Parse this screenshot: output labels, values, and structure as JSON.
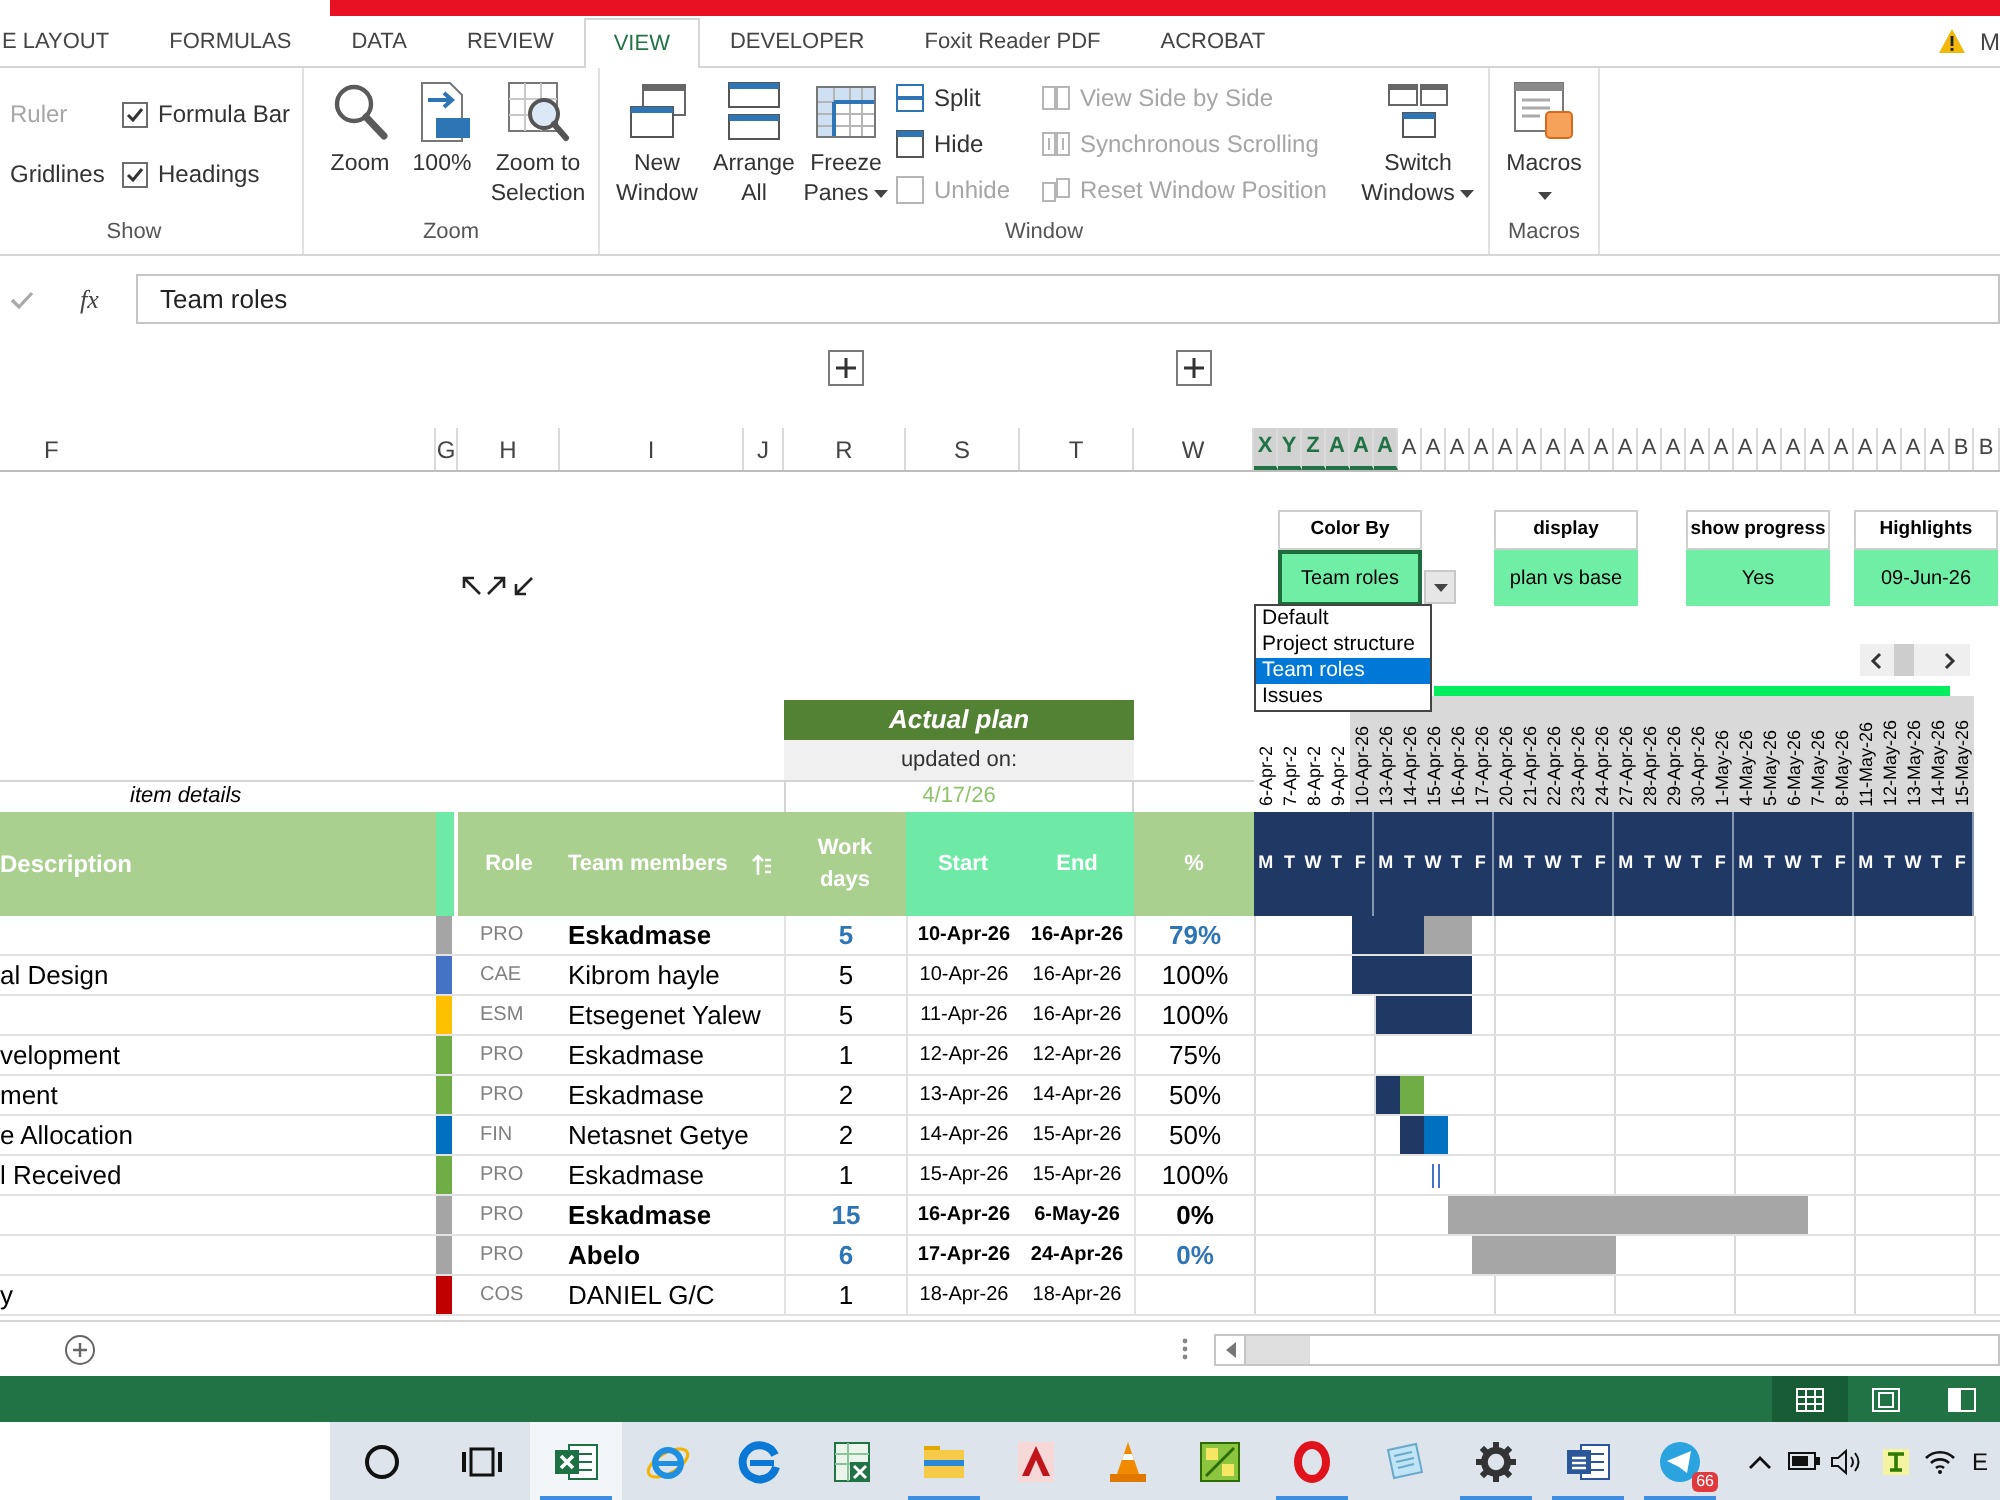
{
  "ribbon_tabs": [
    {
      "label": "E LAYOUT",
      "selected": false
    },
    {
      "label": "FORMULAS",
      "selected": false
    },
    {
      "label": "DATA",
      "selected": false
    },
    {
      "label": "REVIEW",
      "selected": false
    },
    {
      "label": "VIEW",
      "selected": true
    },
    {
      "label": "DEVELOPER",
      "selected": false
    },
    {
      "label": "Foxit Reader PDF",
      "selected": false
    },
    {
      "label": "ACROBAT",
      "selected": false
    }
  ],
  "account": {
    "name": "M"
  },
  "ribbon": {
    "show": {
      "label": "Show",
      "options": [
        {
          "kind": "label",
          "label": "Ruler",
          "disabled": true
        },
        {
          "kind": "checkbox",
          "label": "Formula Bar",
          "checked": true,
          "disabled": false
        },
        {
          "kind": "label",
          "label": "Gridlines",
          "disabled": false
        },
        {
          "kind": "checkbox",
          "label": "Headings",
          "checked": true,
          "disabled": false
        }
      ]
    },
    "zoom": {
      "label": "Zoom",
      "buttons": [
        {
          "label": "Zoom"
        },
        {
          "label": "100%"
        },
        {
          "label": "Zoom to Selection"
        }
      ]
    },
    "window": {
      "label": "Window",
      "large_buttons": [
        {
          "label": "New Window",
          "dropdown": false
        },
        {
          "label": "Arrange All",
          "dropdown": false
        },
        {
          "label": "Freeze Panes",
          "dropdown": true
        }
      ],
      "small_buttons": [
        {
          "label": "Split",
          "disabled": false
        },
        {
          "label": "Hide",
          "disabled": false
        },
        {
          "label": "Unhide",
          "disabled": true
        }
      ],
      "compare_buttons": [
        {
          "label": "View Side by Side",
          "disabled": true
        },
        {
          "label": "Synchronous Scrolling",
          "disabled": true
        },
        {
          "label": "Reset Window Position",
          "disabled": true
        }
      ],
      "switch_button": {
        "label": "Switch Windows",
        "dropdown": true
      }
    },
    "macros": {
      "label": "Macros",
      "button": {
        "label": "Macros",
        "dropdown": true
      }
    }
  },
  "formula_bar": {
    "function_button": "fx",
    "value": "Team roles"
  },
  "columns": [
    {
      "label": "F",
      "outline_expand": false
    },
    {
      "label": "G",
      "outline_expand": false
    },
    {
      "label": "H",
      "outline_expand": false
    },
    {
      "label": "I",
      "outline_expand": false
    },
    {
      "label": "J",
      "outline_expand": false
    },
    {
      "label": "R",
      "outline_expand": true
    },
    {
      "label": "S",
      "outline_expand": false
    },
    {
      "label": "T",
      "outline_expand": false
    },
    {
      "label": "W",
      "outline_expand": true
    }
  ],
  "timeline_columns": [
    {
      "label": "X",
      "selected": true
    },
    {
      "label": "Y",
      "selected": true
    },
    {
      "label": "Z",
      "selected": true
    },
    {
      "label": "A",
      "selected": true
    },
    {
      "label": "A",
      "selected": true
    },
    {
      "label": "A",
      "selected": true
    },
    {
      "label": "A",
      "selected": false
    },
    {
      "label": "A",
      "selected": false
    },
    {
      "label": "A",
      "selected": false
    },
    {
      "label": "A",
      "selected": false
    },
    {
      "label": "A",
      "selected": false
    },
    {
      "label": "A",
      "selected": false
    },
    {
      "label": "A",
      "selected": false
    },
    {
      "label": "A",
      "selected": false
    },
    {
      "label": "A",
      "selected": false
    },
    {
      "label": "A",
      "selected": false
    },
    {
      "label": "A",
      "selected": false
    },
    {
      "label": "A",
      "selected": false
    },
    {
      "label": "A",
      "selected": false
    },
    {
      "label": "A",
      "selected": false
    },
    {
      "label": "A",
      "selected": false
    },
    {
      "label": "A",
      "selected": false
    },
    {
      "label": "A",
      "selected": false
    },
    {
      "label": "A",
      "selected": false
    },
    {
      "label": "A",
      "selected": false
    },
    {
      "label": "A",
      "selected": false
    },
    {
      "label": "A",
      "selected": false
    },
    {
      "label": "A",
      "selected": false
    },
    {
      "label": "A",
      "selected": false
    },
    {
      "label": "B",
      "selected": false
    },
    {
      "label": "B",
      "selected": false
    }
  ],
  "controls": [
    {
      "kind": "dropdown",
      "label": "Color By",
      "value": "Team roles",
      "focused": true
    },
    {
      "kind": "value",
      "label": "display",
      "value": "plan vs base",
      "focused": false
    },
    {
      "kind": "value",
      "label": "show progress",
      "value": "Yes",
      "focused": false
    },
    {
      "kind": "value",
      "label": "Highlights",
      "value": "09-Jun-26",
      "focused": false
    }
  ],
  "dropdown_options": [
    {
      "label": "Default",
      "selected": false
    },
    {
      "label": "Project structure",
      "selected": false
    },
    {
      "label": "Team roles",
      "selected": true
    },
    {
      "label": "Issues",
      "selected": false
    }
  ],
  "plan_header": {
    "title": "Actual plan",
    "updated_label": "updated on:",
    "updated_date": "4/17/26"
  },
  "item_details_label": "item details",
  "dates": [
    {
      "label": "6-Apr-2",
      "shaded": false
    },
    {
      "label": "7-Apr-2",
      "shaded": false
    },
    {
      "label": "8-Apr-2",
      "shaded": false
    },
    {
      "label": "9-Apr-2",
      "shaded": false
    },
    {
      "label": "10-Apr-26",
      "shaded": true
    },
    {
      "label": "13-Apr-26",
      "shaded": true
    },
    {
      "label": "14-Apr-26",
      "shaded": true
    },
    {
      "label": "15-Apr-26",
      "shaded": true
    },
    {
      "label": "16-Apr-26",
      "shaded": true
    },
    {
      "label": "17-Apr-26",
      "shaded": true
    },
    {
      "label": "20-Apr-26",
      "shaded": true
    },
    {
      "label": "21-Apr-26",
      "shaded": true
    },
    {
      "label": "22-Apr-26",
      "shaded": true
    },
    {
      "label": "23-Apr-26",
      "shaded": true
    },
    {
      "label": "24-Apr-26",
      "shaded": true
    },
    {
      "label": "27-Apr-26",
      "shaded": true
    },
    {
      "label": "28-Apr-26",
      "shaded": true
    },
    {
      "label": "29-Apr-26",
      "shaded": true
    },
    {
      "label": "30-Apr-26",
      "shaded": true
    },
    {
      "label": "1-May-26",
      "shaded": true
    },
    {
      "label": "4-May-26",
      "shaded": true
    },
    {
      "label": "5-May-26",
      "shaded": true
    },
    {
      "label": "6-May-26",
      "shaded": true
    },
    {
      "label": "7-May-26",
      "shaded": true
    },
    {
      "label": "8-May-26",
      "shaded": true
    },
    {
      "label": "11-May-26",
      "shaded": true
    },
    {
      "label": "12-May-26",
      "shaded": true
    },
    {
      "label": "13-May-26",
      "shaded": true
    },
    {
      "label": "14-May-26",
      "shaded": true
    },
    {
      "label": "15-May-26",
      "shaded": true
    }
  ],
  "table_headers": {
    "description": "Description",
    "role": "Role",
    "member": "Team members",
    "work_days": "Work days",
    "start": "Start",
    "end": "End",
    "percent": "%"
  },
  "weeks": [
    {
      "days": [
        "M",
        "T",
        "W",
        "T",
        "F"
      ]
    },
    {
      "days": [
        "M",
        "T",
        "W",
        "T",
        "F"
      ]
    },
    {
      "days": [
        "M",
        "T",
        "W",
        "T",
        "F"
      ]
    },
    {
      "days": [
        "M",
        "T",
        "W",
        "T",
        "F"
      ]
    },
    {
      "days": [
        "M",
        "T",
        "W",
        "T",
        "F"
      ]
    },
    {
      "days": [
        "M",
        "T",
        "W",
        "T",
        "F"
      ]
    }
  ],
  "rows": [
    {
      "color": "#a5a5a5",
      "role": "PRO",
      "member": "Eskadmase",
      "work_days": "5",
      "start": "10-Apr-26",
      "end": "16-Apr-26",
      "percent": "79%",
      "summary": true,
      "percent_accent": true,
      "timeline": [
        {
          "kind": "gap"
        },
        {
          "kind": "gap"
        },
        {
          "kind": "gap"
        },
        {
          "kind": "gap"
        },
        {
          "kind": "bar",
          "color": "#203864"
        },
        {
          "kind": "bar",
          "color": "#203864"
        },
        {
          "kind": "bar",
          "color": "#203864"
        },
        {
          "kind": "bar",
          "color": "#a6a6a6"
        },
        {
          "kind": "bar",
          "color": "#a6a6a6"
        },
        {
          "kind": "gap"
        },
        {
          "kind": "gap"
        },
        {
          "kind": "gap"
        },
        {
          "kind": "gap"
        },
        {
          "kind": "gap"
        },
        {
          "kind": "gap"
        },
        {
          "kind": "gap"
        },
        {
          "kind": "gap"
        },
        {
          "kind": "gap"
        },
        {
          "kind": "gap"
        },
        {
          "kind": "gap"
        },
        {
          "kind": "gap"
        },
        {
          "kind": "gap"
        },
        {
          "kind": "gap"
        },
        {
          "kind": "gap"
        },
        {
          "kind": "gap"
        },
        {
          "kind": "gap"
        },
        {
          "kind": "gap"
        },
        {
          "kind": "gap"
        },
        {
          "kind": "gap"
        },
        {
          "kind": "gap"
        }
      ]
    },
    {
      "description": "al Design",
      "color": "#4472c4",
      "role": "CAE",
      "member": "Kibrom hayle",
      "work_days": "5",
      "start": "10-Apr-26",
      "end": "16-Apr-26",
      "percent": "100%",
      "summary": false,
      "percent_accent": false,
      "timeline": [
        {
          "kind": "gap"
        },
        {
          "kind": "gap"
        },
        {
          "kind": "gap"
        },
        {
          "kind": "gap"
        },
        {
          "kind": "bar",
          "color": "#203864"
        },
        {
          "kind": "bar",
          "color": "#203864"
        },
        {
          "kind": "bar",
          "color": "#203864"
        },
        {
          "kind": "bar",
          "color": "#203864"
        },
        {
          "kind": "bar",
          "color": "#203864"
        },
        {
          "kind": "gap"
        },
        {
          "kind": "gap"
        },
        {
          "kind": "gap"
        },
        {
          "kind": "gap"
        },
        {
          "kind": "gap"
        },
        {
          "kind": "gap"
        },
        {
          "kind": "gap"
        },
        {
          "kind": "gap"
        },
        {
          "kind": "gap"
        },
        {
          "kind": "gap"
        },
        {
          "kind": "gap"
        },
        {
          "kind": "gap"
        },
        {
          "kind": "gap"
        },
        {
          "kind": "gap"
        },
        {
          "kind": "gap"
        },
        {
          "kind": "gap"
        },
        {
          "kind": "gap"
        },
        {
          "kind": "gap"
        },
        {
          "kind": "gap"
        },
        {
          "kind": "gap"
        },
        {
          "kind": "gap"
        }
      ]
    },
    {
      "color": "#ffc000",
      "role": "ESM",
      "member": "Etsegenet Yalew",
      "work_days": "5",
      "start": "11-Apr-26",
      "end": "16-Apr-26",
      "percent": "100%",
      "summary": false,
      "percent_accent": false,
      "timeline": [
        {
          "kind": "gap"
        },
        {
          "kind": "gap"
        },
        {
          "kind": "gap"
        },
        {
          "kind": "gap"
        },
        {
          "kind": "gap"
        },
        {
          "kind": "bar",
          "color": "#203864"
        },
        {
          "kind": "bar",
          "color": "#203864"
        },
        {
          "kind": "bar",
          "color": "#203864"
        },
        {
          "kind": "bar",
          "color": "#203864"
        },
        {
          "kind": "gap"
        },
        {
          "kind": "gap"
        },
        {
          "kind": "gap"
        },
        {
          "kind": "gap"
        },
        {
          "kind": "gap"
        },
        {
          "kind": "gap"
        },
        {
          "kind": "gap"
        },
        {
          "kind": "gap"
        },
        {
          "kind": "gap"
        },
        {
          "kind": "gap"
        },
        {
          "kind": "gap"
        },
        {
          "kind": "gap"
        },
        {
          "kind": "gap"
        },
        {
          "kind": "gap"
        },
        {
          "kind": "gap"
        },
        {
          "kind": "gap"
        },
        {
          "kind": "gap"
        },
        {
          "kind": "gap"
        },
        {
          "kind": "gap"
        },
        {
          "kind": "gap"
        },
        {
          "kind": "gap"
        }
      ]
    },
    {
      "description": "velopment",
      "color": "#70ad47",
      "role": "PRO",
      "member": "Eskadmase",
      "work_days": "1",
      "start": "12-Apr-26",
      "end": "12-Apr-26",
      "percent": "75%",
      "summary": false,
      "percent_accent": false,
      "timeline": [
        {
          "kind": "gap"
        },
        {
          "kind": "gap"
        },
        {
          "kind": "gap"
        },
        {
          "kind": "gap"
        },
        {
          "kind": "gap"
        },
        {
          "kind": "gap"
        },
        {
          "kind": "gap"
        },
        {
          "kind": "gap"
        },
        {
          "kind": "gap"
        },
        {
          "kind": "gap"
        },
        {
          "kind": "gap"
        },
        {
          "kind": "gap"
        },
        {
          "kind": "gap"
        },
        {
          "kind": "gap"
        },
        {
          "kind": "gap"
        },
        {
          "kind": "gap"
        },
        {
          "kind": "gap"
        },
        {
          "kind": "gap"
        },
        {
          "kind": "gap"
        },
        {
          "kind": "gap"
        },
        {
          "kind": "gap"
        },
        {
          "kind": "gap"
        },
        {
          "kind": "gap"
        },
        {
          "kind": "gap"
        },
        {
          "kind": "gap"
        },
        {
          "kind": "gap"
        },
        {
          "kind": "gap"
        },
        {
          "kind": "gap"
        },
        {
          "kind": "gap"
        },
        {
          "kind": "gap"
        }
      ]
    },
    {
      "description": "ment",
      "color": "#70ad47",
      "role": "PRO",
      "member": "Eskadmase",
      "work_days": "2",
      "start": "13-Apr-26",
      "end": "14-Apr-26",
      "percent": "50%",
      "summary": false,
      "percent_accent": false,
      "timeline": [
        {
          "kind": "gap"
        },
        {
          "kind": "gap"
        },
        {
          "kind": "gap"
        },
        {
          "kind": "gap"
        },
        {
          "kind": "gap"
        },
        {
          "kind": "bar",
          "color": "#203864"
        },
        {
          "kind": "bar",
          "color": "#70ad47"
        },
        {
          "kind": "gap"
        },
        {
          "kind": "gap"
        },
        {
          "kind": "gap"
        },
        {
          "kind": "gap"
        },
        {
          "kind": "gap"
        },
        {
          "kind": "gap"
        },
        {
          "kind": "gap"
        },
        {
          "kind": "gap"
        },
        {
          "kind": "gap"
        },
        {
          "kind": "gap"
        },
        {
          "kind": "gap"
        },
        {
          "kind": "gap"
        },
        {
          "kind": "gap"
        },
        {
          "kind": "gap"
        },
        {
          "kind": "gap"
        },
        {
          "kind": "gap"
        },
        {
          "kind": "gap"
        },
        {
          "kind": "gap"
        },
        {
          "kind": "gap"
        },
        {
          "kind": "gap"
        },
        {
          "kind": "gap"
        },
        {
          "kind": "gap"
        },
        {
          "kind": "gap"
        }
      ]
    },
    {
      "description": "e Allocation",
      "color": "#0070c0",
      "role": "FIN",
      "member": "Netasnet Getye",
      "work_days": "2",
      "start": "14-Apr-26",
      "end": "15-Apr-26",
      "percent": "50%",
      "summary": false,
      "percent_accent": false,
      "timeline": [
        {
          "kind": "gap"
        },
        {
          "kind": "gap"
        },
        {
          "kind": "gap"
        },
        {
          "kind": "gap"
        },
        {
          "kind": "gap"
        },
        {
          "kind": "gap"
        },
        {
          "kind": "bar",
          "color": "#203864"
        },
        {
          "kind": "bar",
          "color": "#0070c0"
        },
        {
          "kind": "gap"
        },
        {
          "kind": "gap"
        },
        {
          "kind": "gap"
        },
        {
          "kind": "gap"
        },
        {
          "kind": "gap"
        },
        {
          "kind": "gap"
        },
        {
          "kind": "gap"
        },
        {
          "kind": "gap"
        },
        {
          "kind": "gap"
        },
        {
          "kind": "gap"
        },
        {
          "kind": "gap"
        },
        {
          "kind": "gap"
        },
        {
          "kind": "gap"
        },
        {
          "kind": "gap"
        },
        {
          "kind": "gap"
        },
        {
          "kind": "gap"
        },
        {
          "kind": "gap"
        },
        {
          "kind": "gap"
        },
        {
          "kind": "gap"
        },
        {
          "kind": "gap"
        },
        {
          "kind": "gap"
        },
        {
          "kind": "gap"
        }
      ]
    },
    {
      "description": "l Received",
      "color": "#70ad47",
      "role": "PRO",
      "member": "Eskadmase",
      "work_days": "1",
      "start": "15-Apr-26",
      "end": "15-Apr-26",
      "percent": "100%",
      "summary": false,
      "percent_accent": false,
      "timeline": [
        {
          "kind": "gap"
        },
        {
          "kind": "gap"
        },
        {
          "kind": "gap"
        },
        {
          "kind": "gap"
        },
        {
          "kind": "gap"
        },
        {
          "kind": "gap"
        },
        {
          "kind": "gap"
        },
        {
          "kind": "mark",
          "color": "#4472c4"
        },
        {
          "kind": "gap"
        },
        {
          "kind": "gap"
        },
        {
          "kind": "gap"
        },
        {
          "kind": "gap"
        },
        {
          "kind": "gap"
        },
        {
          "kind": "gap"
        },
        {
          "kind": "gap"
        },
        {
          "kind": "gap"
        },
        {
          "kind": "gap"
        },
        {
          "kind": "gap"
        },
        {
          "kind": "gap"
        },
        {
          "kind": "gap"
        },
        {
          "kind": "gap"
        },
        {
          "kind": "gap"
        },
        {
          "kind": "gap"
        },
        {
          "kind": "gap"
        },
        {
          "kind": "gap"
        },
        {
          "kind": "gap"
        },
        {
          "kind": "gap"
        },
        {
          "kind": "gap"
        },
        {
          "kind": "gap"
        },
        {
          "kind": "gap"
        }
      ]
    },
    {
      "color": "#a5a5a5",
      "role": "PRO",
      "member": "Eskadmase",
      "work_days": "15",
      "start": "16-Apr-26",
      "end": "6-May-26",
      "percent": "0%",
      "summary": true,
      "percent_accent": false,
      "timeline": [
        {
          "kind": "gap"
        },
        {
          "kind": "gap"
        },
        {
          "kind": "gap"
        },
        {
          "kind": "gap"
        },
        {
          "kind": "gap"
        },
        {
          "kind": "gap"
        },
        {
          "kind": "gap"
        },
        {
          "kind": "gap"
        },
        {
          "kind": "bar",
          "color": "#a6a6a6"
        },
        {
          "kind": "bar",
          "color": "#a6a6a6"
        },
        {
          "kind": "bar",
          "color": "#a6a6a6"
        },
        {
          "kind": "bar",
          "color": "#a6a6a6"
        },
        {
          "kind": "bar",
          "color": "#a6a6a6"
        },
        {
          "kind": "bar",
          "color": "#a6a6a6"
        },
        {
          "kind": "bar",
          "color": "#a6a6a6"
        },
        {
          "kind": "bar",
          "color": "#a6a6a6"
        },
        {
          "kind": "bar",
          "color": "#a6a6a6"
        },
        {
          "kind": "bar",
          "color": "#a6a6a6"
        },
        {
          "kind": "bar",
          "color": "#a6a6a6"
        },
        {
          "kind": "bar",
          "color": "#a6a6a6"
        },
        {
          "kind": "bar",
          "color": "#a6a6a6"
        },
        {
          "kind": "bar",
          "color": "#a6a6a6"
        },
        {
          "kind": "bar",
          "color": "#a6a6a6"
        },
        {
          "kind": "gap"
        },
        {
          "kind": "gap"
        },
        {
          "kind": "gap"
        },
        {
          "kind": "gap"
        },
        {
          "kind": "gap"
        },
        {
          "kind": "gap"
        },
        {
          "kind": "gap"
        }
      ]
    },
    {
      "color": "#a5a5a5",
      "role": "PRO",
      "member": "Abelo",
      "work_days": "6",
      "start": "17-Apr-26",
      "end": "24-Apr-26",
      "percent": "0%",
      "summary": true,
      "percent_accent": true,
      "timeline": [
        {
          "kind": "gap"
        },
        {
          "kind": "gap"
        },
        {
          "kind": "gap"
        },
        {
          "kind": "gap"
        },
        {
          "kind": "gap"
        },
        {
          "kind": "gap"
        },
        {
          "kind": "gap"
        },
        {
          "kind": "gap"
        },
        {
          "kind": "gap"
        },
        {
          "kind": "bar",
          "color": "#a6a6a6"
        },
        {
          "kind": "bar",
          "color": "#a6a6a6"
        },
        {
          "kind": "bar",
          "color": "#a6a6a6"
        },
        {
          "kind": "bar",
          "color": "#a6a6a6"
        },
        {
          "kind": "bar",
          "color": "#a6a6a6"
        },
        {
          "kind": "bar",
          "color": "#a6a6a6"
        },
        {
          "kind": "gap"
        },
        {
          "kind": "gap"
        },
        {
          "kind": "gap"
        },
        {
          "kind": "gap"
        },
        {
          "kind": "gap"
        },
        {
          "kind": "gap"
        },
        {
          "kind": "gap"
        },
        {
          "kind": "gap"
        },
        {
          "kind": "gap"
        },
        {
          "kind": "gap"
        },
        {
          "kind": "gap"
        },
        {
          "kind": "gap"
        },
        {
          "kind": "gap"
        },
        {
          "kind": "gap"
        },
        {
          "kind": "gap"
        }
      ]
    },
    {
      "description": "y",
      "color": "#c00000",
      "role": "COS",
      "member": "DANIEL G/C",
      "work_days": "1",
      "start": "18-Apr-26",
      "end": "18-Apr-26",
      "summary": false,
      "timeline": [
        {
          "kind": "gap"
        },
        {
          "kind": "gap"
        },
        {
          "kind": "gap"
        },
        {
          "kind": "gap"
        },
        {
          "kind": "gap"
        },
        {
          "kind": "gap"
        },
        {
          "kind": "gap"
        },
        {
          "kind": "gap"
        },
        {
          "kind": "gap"
        },
        {
          "kind": "gap"
        },
        {
          "kind": "gap"
        },
        {
          "kind": "gap"
        },
        {
          "kind": "gap"
        },
        {
          "kind": "gap"
        },
        {
          "kind": "gap"
        },
        {
          "kind": "gap"
        },
        {
          "kind": "gap"
        },
        {
          "kind": "gap"
        },
        {
          "kind": "gap"
        },
        {
          "kind": "gap"
        },
        {
          "kind": "gap"
        },
        {
          "kind": "gap"
        },
        {
          "kind": "gap"
        },
        {
          "kind": "gap"
        },
        {
          "kind": "gap"
        },
        {
          "kind": "gap"
        },
        {
          "kind": "gap"
        },
        {
          "kind": "gap"
        },
        {
          "kind": "gap"
        },
        {
          "kind": "gap"
        }
      ]
    }
  ],
  "view_buttons": [
    {
      "selected": true
    },
    {
      "selected": false
    },
    {
      "selected": false
    }
  ],
  "taskbar": {
    "apps": [
      {
        "running": false,
        "selected": false
      },
      {
        "running": false,
        "selected": false
      },
      {
        "running": true,
        "selected": true
      },
      {
        "running": false,
        "selected": false
      },
      {
        "running": false,
        "selected": false
      },
      {
        "running": false,
        "selected": false
      },
      {
        "running": true,
        "selected": false
      },
      {
        "running": false,
        "selected": false
      },
      {
        "running": false,
        "selected": false
      },
      {
        "running": false,
        "selected": false
      },
      {
        "running": true,
        "selected": false
      },
      {
        "running": false,
        "selected": false
      },
      {
        "running": true,
        "selected": false
      },
      {
        "running": true,
        "selected": false
      },
      {
        "running": true,
        "selected": false,
        "badge": "66"
      }
    ],
    "language": "E"
  }
}
